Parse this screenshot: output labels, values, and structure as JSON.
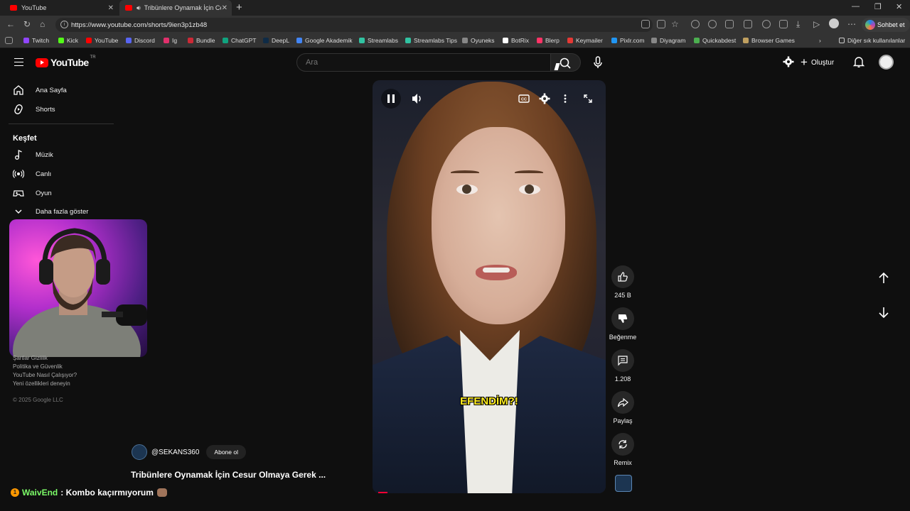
{
  "browser": {
    "tabs": [
      {
        "label": "YouTube"
      },
      {
        "label": "Tribünlere Oynamak İçin Ce"
      }
    ],
    "url": "https://www.youtube.com/shorts/9ien3p1zb48",
    "copilot_label": "Sohbet et",
    "bookmarks": [
      "Twitch",
      "Kick",
      "YouTube",
      "Discord",
      "Ig",
      "Bundle",
      "ChatGPT",
      "DeepL",
      "Google Akademik",
      "Streamlabs",
      "Streamlabs Tips",
      "Oyuneks",
      "BotRix",
      "Blerp",
      "Keymailer",
      "Pixlr.com",
      "Diyagram",
      "Quickabdest",
      "Browser Games"
    ],
    "other_bookmarks": "Diğer sık kullanılanlar",
    "bookmark_colors": [
      "#9146ff",
      "#53fc18",
      "#ff0000",
      "#5865f2",
      "#e1306c",
      "#cc2936",
      "#10a37f",
      "#0f2b46",
      "#4285f4",
      "#31c3a2",
      "#31c3a2",
      "#888888",
      "#ffffff",
      "#ff3366",
      "#e53935",
      "#2196f3",
      "#888888",
      "#4caf50",
      "#c0a060"
    ]
  },
  "header": {
    "logo_text": "YouTube",
    "country_code": "TR",
    "search_placeholder": "Ara",
    "create_label": "Oluştur"
  },
  "sidebar": {
    "items": [
      {
        "label": "Ana Sayfa",
        "icon": "home-icon"
      },
      {
        "label": "Shorts",
        "icon": "shorts-icon"
      }
    ],
    "explore_title": "Keşfet",
    "explore_items": [
      {
        "label": "Müzik",
        "icon": "music-icon"
      },
      {
        "label": "Canlı",
        "icon": "live-icon"
      },
      {
        "label": "Oyun",
        "icon": "gaming-icon"
      },
      {
        "label": "Daha fazla göster",
        "icon": "chevron-down-icon"
      }
    ],
    "footer_links": [
      "Şartlar   Gizlilik",
      "Politika ve Güvenlik",
      "YouTube Nasıl Çalışıyor?",
      "Yeni özellikleri deneyin"
    ],
    "copyright": "© 2025 Google LLC"
  },
  "short": {
    "channel": "@SEKANS360",
    "subscribe_label": "Abone ol",
    "title": "Tribünlere Oynamak İçin Cesur Olmaya Gerek ...",
    "caption": "EFENDİM?!",
    "progress_fraction": 0.04,
    "actions": [
      {
        "label": "245 B",
        "icon": "like-icon"
      },
      {
        "label": "Beğenme",
        "icon": "dislike-icon"
      },
      {
        "label": "1.208",
        "icon": "comment-icon"
      },
      {
        "label": "Paylaş",
        "icon": "share-icon"
      },
      {
        "label": "Remix",
        "icon": "remix-icon"
      }
    ]
  },
  "stream_overlay": {
    "chat_user": "WaivEnd",
    "chat_message": ": Kombo kaçırmıyorum"
  }
}
